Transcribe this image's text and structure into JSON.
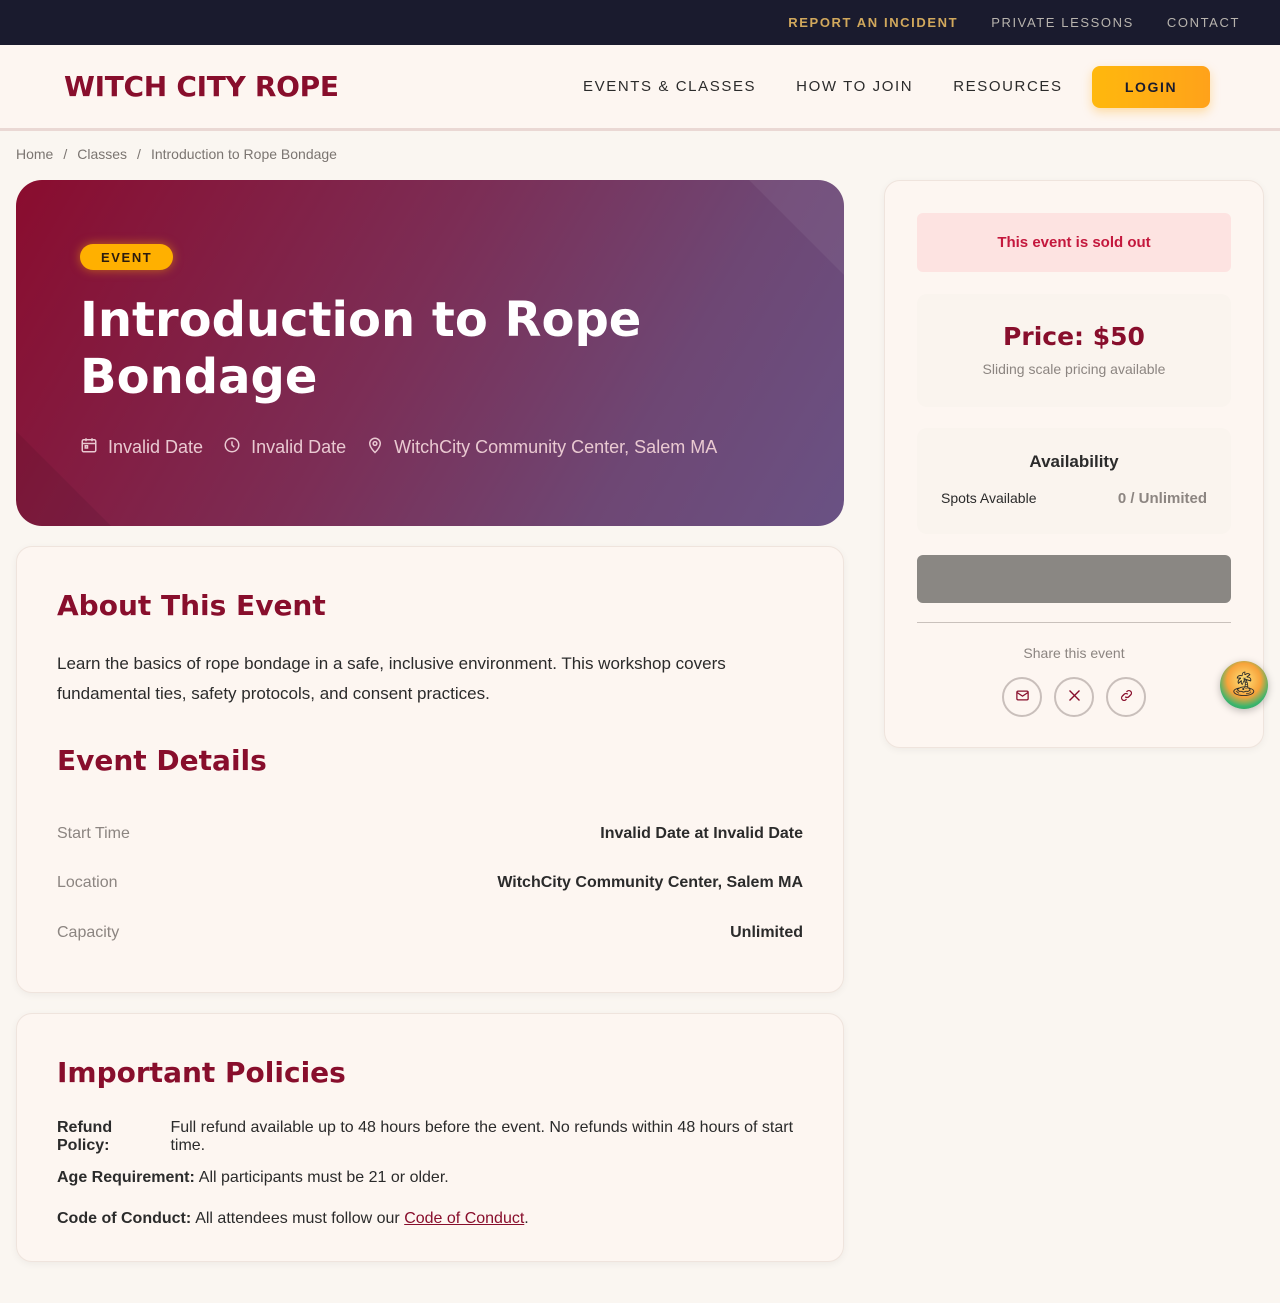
{
  "utility_nav": {
    "report": "REPORT AN INCIDENT",
    "lessons": "PRIVATE LESSONS",
    "contact": "CONTACT"
  },
  "header": {
    "logo": "WITCH CITY ROPE",
    "nav": {
      "events": "EVENTS & CLASSES",
      "join": "HOW TO JOIN",
      "resources": "RESOURCES"
    },
    "login_label": "LOGIN"
  },
  "breadcrumb": {
    "home": "Home",
    "classes": "Classes",
    "current": "Introduction to Rope Bondage",
    "sep": "/"
  },
  "hero": {
    "badge": "EVENT",
    "title": "Introduction to Rope Bondage",
    "date": "Invalid Date",
    "time": "Invalid Date",
    "location": "WitchCity Community Center, Salem MA"
  },
  "about": {
    "heading": "About This Event",
    "description": "Learn the basics of rope bondage in a safe, inclusive environment. This workshop covers fundamental ties, safety protocols, and consent practices.",
    "details_heading": "Event Details",
    "details": [
      {
        "label": "Start Time",
        "value": "Invalid Date at Invalid Date"
      },
      {
        "label": "Location",
        "value": "WitchCity Community Center, Salem MA"
      },
      {
        "label": "Capacity",
        "value": "Unlimited"
      }
    ]
  },
  "policies": {
    "heading": "Important Policies",
    "refund_label": "Refund Policy:",
    "refund_text": "Full refund available up to 48 hours before the event. No refunds within 48 hours of start time.",
    "age_label": "Age Requirement:",
    "age_text": "All participants must be 21 or older.",
    "conduct_label": "Code of Conduct:",
    "conduct_text": "All attendees must follow our",
    "conduct_link": "Code of Conduct",
    "conduct_end": "."
  },
  "sidebar": {
    "sold_out": "This event is sold out",
    "price": "Price: $50",
    "price_note": "Sliding scale pricing available",
    "availability_title": "Availability",
    "spots_label": "Spots Available",
    "spots_value": "0 / Unlimited",
    "share_label": "Share this event",
    "share_icons": [
      "email-icon",
      "x-icon",
      "link-icon"
    ]
  },
  "colors": {
    "brand": "#880e2c",
    "accent": "#ffb000",
    "utility_bg": "#1a1b2e",
    "sold_out_text": "#c4183d"
  }
}
